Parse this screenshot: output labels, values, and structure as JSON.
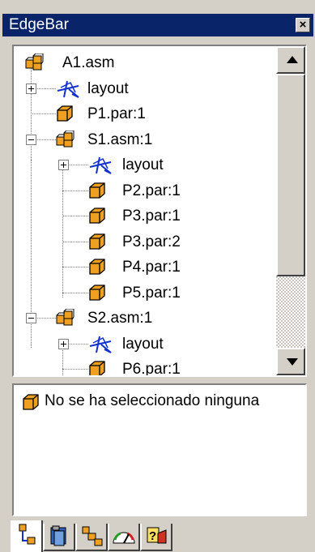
{
  "window": {
    "title": "EdgeBar",
    "close_icon": "close-icon"
  },
  "tree": {
    "nodes": [
      {
        "label": "A1.asm",
        "icon": "assembly-icon",
        "level": 0,
        "expander": "none"
      },
      {
        "label": "layout",
        "icon": "layout-sketch-icon",
        "level": 1,
        "expander": "plus"
      },
      {
        "label": "P1.par:1",
        "icon": "part-icon",
        "level": 1,
        "expander": "none"
      },
      {
        "label": "S1.asm:1",
        "icon": "assembly-icon",
        "level": 1,
        "expander": "minus"
      },
      {
        "label": "layout",
        "icon": "layout-sketch-icon",
        "level": 2,
        "expander": "plus"
      },
      {
        "label": "P2.par:1",
        "icon": "part-icon",
        "level": 2,
        "expander": "none"
      },
      {
        "label": "P3.par:1",
        "icon": "part-icon",
        "level": 2,
        "expander": "none"
      },
      {
        "label": "P3.par:2",
        "icon": "part-icon",
        "level": 2,
        "expander": "none"
      },
      {
        "label": "P4.par:1",
        "icon": "part-icon",
        "level": 2,
        "expander": "none"
      },
      {
        "label": "P5.par:1",
        "icon": "part-icon",
        "level": 2,
        "expander": "none"
      },
      {
        "label": "S2.asm:1",
        "icon": "assembly-icon",
        "level": 1,
        "expander": "minus"
      },
      {
        "label": "layout",
        "icon": "layout-sketch-icon",
        "level": 2,
        "expander": "plus"
      },
      {
        "label": "P6.par:1",
        "icon": "part-icon",
        "level": 2,
        "expander": "none"
      }
    ]
  },
  "info": {
    "icon": "part-icon",
    "text": "No se ha seleccionado ninguna"
  },
  "tabs": [
    {
      "icon": "feature-pathfinder-icon",
      "active": true
    },
    {
      "icon": "library-icon",
      "active": false
    },
    {
      "icon": "assembly-pathfinder-icon",
      "active": false
    },
    {
      "icon": "gauge-icon",
      "active": false
    },
    {
      "icon": "help-icon",
      "active": false
    }
  ],
  "colors": {
    "titlebar": "#0a246a",
    "face": "#d4d0c8",
    "part_orange": "#f0a020",
    "layout_blue": "#1030d0"
  }
}
